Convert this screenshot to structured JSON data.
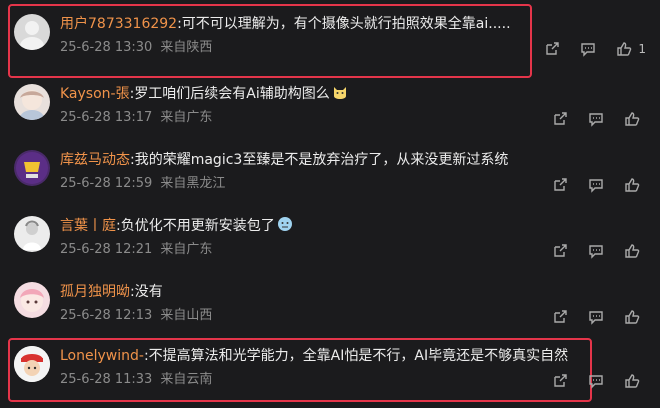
{
  "comments": [
    {
      "user": "用户7873316292",
      "sep": ":",
      "text": "可不可以理解为，有个摄像头就行拍照效果全靠ai.....",
      "date": "25-6-28 13:30",
      "location": "来自陕西",
      "likes": "1",
      "avatar": "default-avatar",
      "highlighted": true,
      "emoji": ""
    },
    {
      "user": "Kayson-張",
      "sep": ":",
      "text": "罗工咱们后续会有Ai辅助构图么",
      "date": "25-6-28 13:17",
      "location": "来自广东",
      "likes": "",
      "avatar": "illustrated-girl-avatar",
      "highlighted": false,
      "emoji": "cat-face-emoji"
    },
    {
      "user": "库兹马动态",
      "sep": ":",
      "text": "我的荣耀magic3至臻是不是放弃治疗了，从来没更新过系统",
      "date": "25-6-28 12:59",
      "location": "来自黑龙江",
      "likes": "",
      "avatar": "purple-emblem-avatar",
      "highlighted": false,
      "emoji": ""
    },
    {
      "user": "言葉丨庭",
      "sep": ":",
      "text": "负优化不用更新安装包了",
      "date": "25-6-28 12:21",
      "location": "来自广东",
      "likes": "",
      "avatar": "white-figure-avatar",
      "highlighted": false,
      "emoji": "thinking-emoji"
    },
    {
      "user": "孤月独明呦",
      "sep": ":",
      "text": "没有",
      "date": "25-6-28 12:13",
      "location": "来自山西",
      "likes": "",
      "avatar": "pink-anime-avatar",
      "highlighted": false,
      "emoji": ""
    },
    {
      "user": "Lonelywind-",
      "sep": ":",
      "text": "不提高算法和光学能力，全靠AI怕是不行，AI毕竟还是不够真实自然",
      "date": "25-6-28 11:33",
      "location": "来自云南",
      "likes": "",
      "avatar": "red-cap-character-avatar",
      "highlighted": true,
      "emoji": ""
    }
  ],
  "icons": {
    "share": "share-icon",
    "reply": "comment-icon",
    "like": "thumbs-up-icon"
  },
  "colors": {
    "background": "#1b1b1d",
    "username": "#f0934a",
    "highlight": "#e5354a",
    "meta": "#8b8b8b"
  }
}
